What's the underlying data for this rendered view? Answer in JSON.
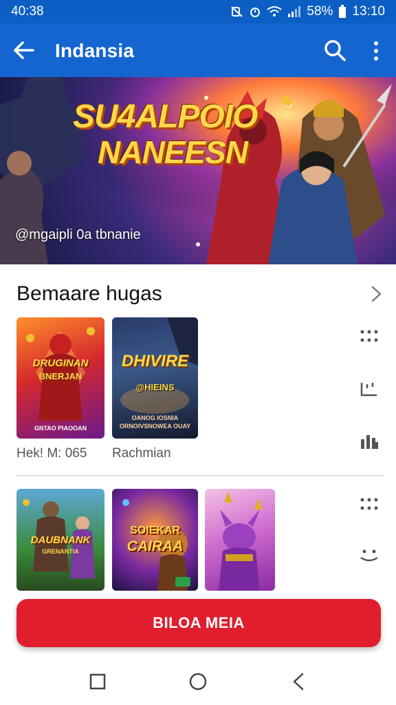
{
  "status_bar": {
    "time": "40:38",
    "battery_percent": "58%",
    "clock": "13:10"
  },
  "app_bar": {
    "title": "Indansia"
  },
  "hero": {
    "title_line1": "SU4ALPOIO",
    "title_line2": "NANEESN",
    "subtitle": "@mgaipli 0a tbnanie"
  },
  "section": {
    "title": "Bemaare hugas"
  },
  "cards_row1": [
    {
      "title_line1": "DRUGINAN",
      "title_line2": "BNERJAN",
      "footer": "GNTAO PIAOOAN",
      "caption": "Hek! M: 065"
    },
    {
      "title_line1": "DHIVIRE",
      "title_line2": "@HIEINS",
      "footer": "OANOG IOSNIA ORNOIVSNOWEA OUAY",
      "caption": "Rachmian"
    }
  ],
  "cards_row2": [
    {
      "title_line1": "DAUBNANK",
      "title_line2": "GRENANTIA"
    },
    {
      "title_line1": "SOIEKAR",
      "title_line2": "CAIRAA"
    },
    {
      "title_line1": ""
    }
  ],
  "cta": {
    "label": "BILOA MEIA"
  },
  "colors": {
    "app_bar": "#1565d0",
    "status_bar": "#0b5fc4",
    "cta": "#e01e2d"
  }
}
